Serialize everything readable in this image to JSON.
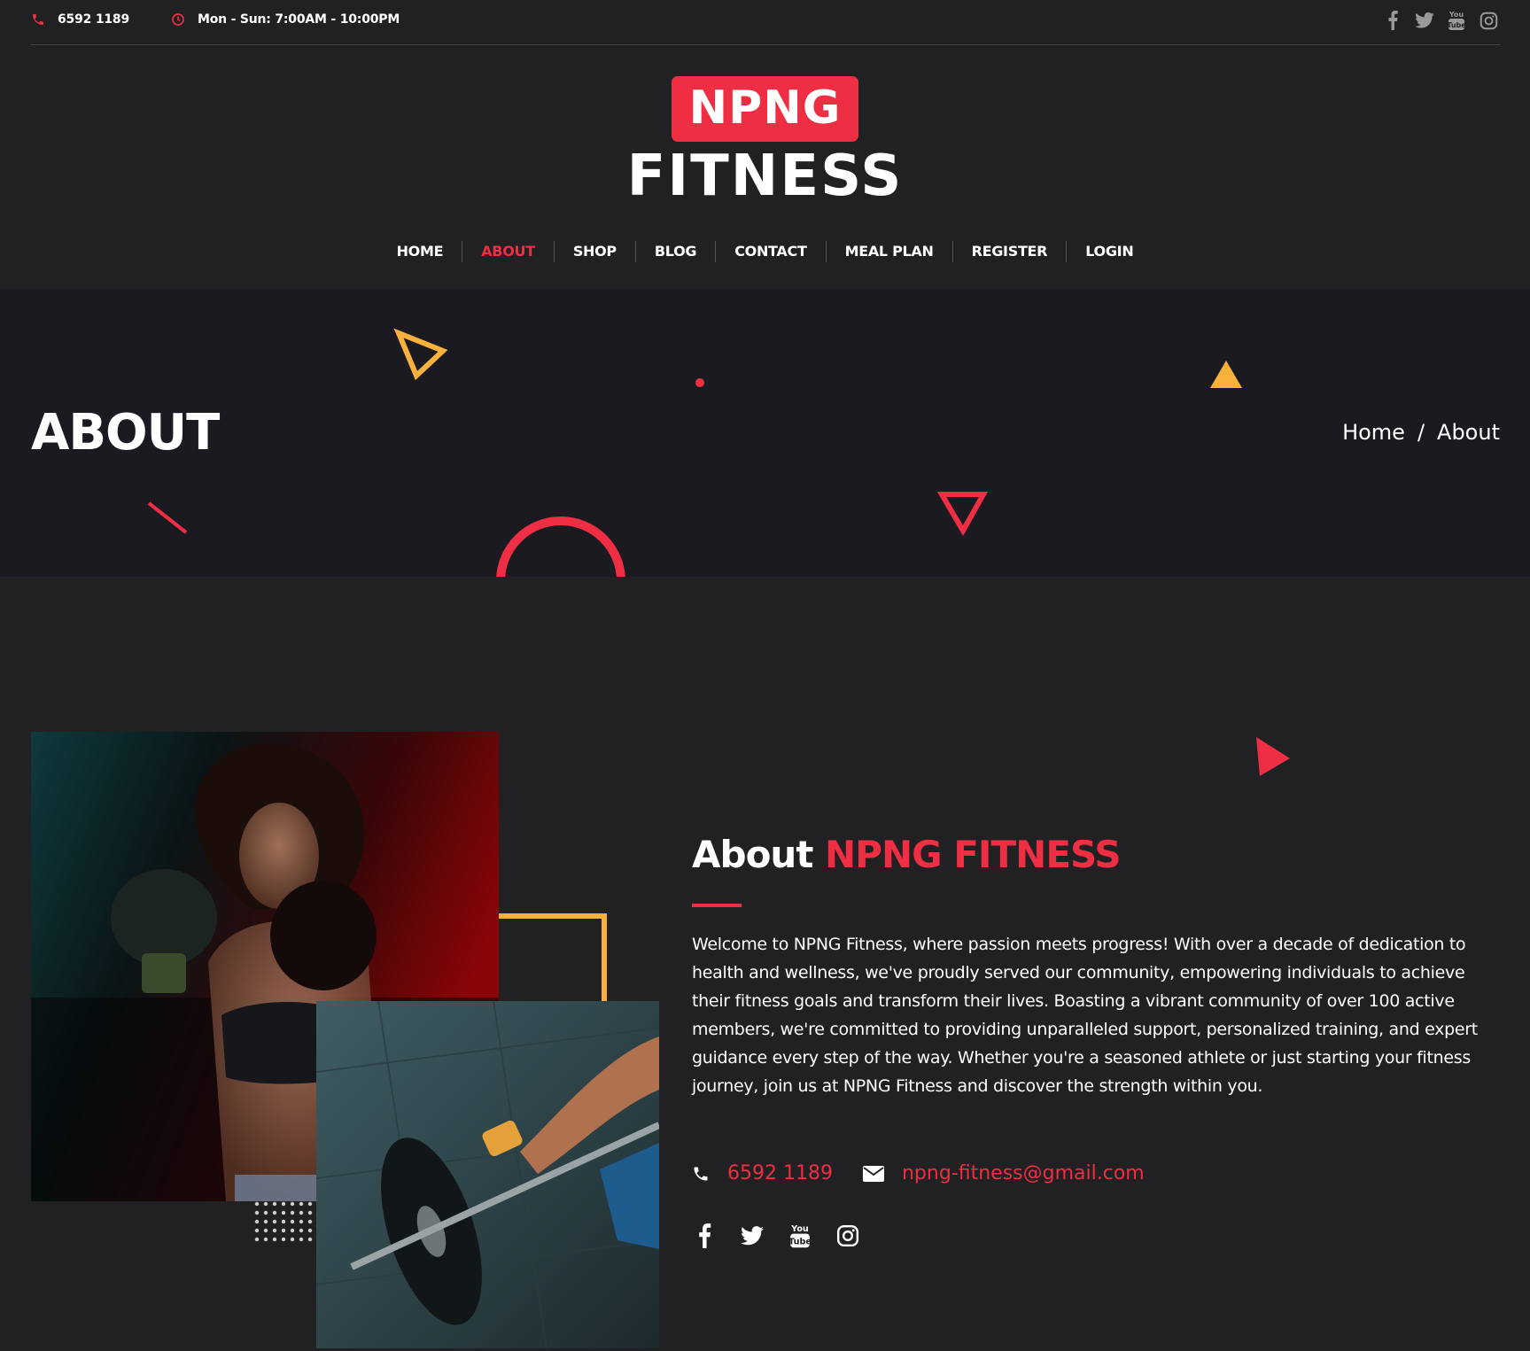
{
  "topbar": {
    "phone": "6592 1189",
    "hours": "Mon - Sun: 7:00AM - 10:00PM",
    "social_icons": [
      "facebook-icon",
      "twitter-icon",
      "youtube-icon",
      "instagram-icon"
    ]
  },
  "logo": {
    "badge": "NPNG",
    "word": "FITNESS"
  },
  "nav": {
    "items": [
      {
        "label": "HOME"
      },
      {
        "label": "ABOUT",
        "active": true
      },
      {
        "label": "SHOP"
      },
      {
        "label": "BLOG"
      },
      {
        "label": "CONTACT"
      },
      {
        "label": "MEAL PLAN"
      },
      {
        "label": "REGISTER"
      },
      {
        "label": "LOGIN"
      }
    ]
  },
  "banner": {
    "title": "ABOUT",
    "breadcrumb_home": "Home",
    "breadcrumb_sep": "/",
    "breadcrumb_current": "About"
  },
  "about": {
    "title_prefix": "About",
    "title_brand": "NPNG FITNESS",
    "text": "Welcome to NPNG Fitness, where passion meets progress! With over a decade of dedication to health and wellness, we've proudly served our community, empowering individuals to achieve their fitness goals and transform their lives. Boasting a vibrant community of over 100 active members, we're committed to providing unparalleled support, personalized training, and expert guidance every step of the way. Whether you're a seasoned athlete or just starting your fitness journey, join us at NPNG Fitness and discover the strength within you.",
    "phone": "6592 1189",
    "email": "npng-fitness@gmail.com",
    "social_icons": [
      "facebook-icon",
      "twitter-icon",
      "youtube-icon",
      "instagram-icon"
    ]
  },
  "colors": {
    "accent": "#ee2e43",
    "yellow": "#f8b13d",
    "bg": "#212124",
    "banner_bg": "#1b1a21"
  }
}
